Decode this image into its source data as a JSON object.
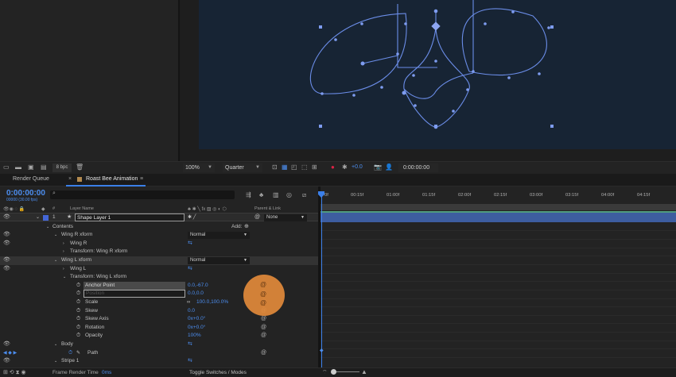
{
  "project_footer": {
    "bpc_label": "8 bpc"
  },
  "viewer_footer": {
    "zoom": "100%",
    "resolution": "Quarter",
    "exposure": "+0.0",
    "timecode": "0:00:00:00"
  },
  "tabs": [
    {
      "label": "Render Queue"
    },
    {
      "label": "Roast Bee Animation"
    }
  ],
  "timeline": {
    "current_time": "0:00:00:00",
    "frame_info": "00000 (30.00 fps)",
    "search_placeholder": "",
    "col_hash": "#",
    "col_layer_name": "Layer Name",
    "col_parent": "Parent & Link"
  },
  "layer": {
    "index": "1",
    "name": "Shape Layer 1",
    "parent": "None",
    "contents_label": "Contents",
    "add_label": "Add:"
  },
  "rows": {
    "wing_r_xform": "Wing R xform",
    "wing_r_mode": "Normal",
    "wing_r": "Wing R",
    "transform_wing_r": "Transform: Wing R xform",
    "wing_l_xform": "Wing L xform",
    "wing_l_mode": "Normal",
    "wing_l": "Wing L",
    "transform_wing_l": "Transform: Wing L xform",
    "anchor_point": "Anchor Point",
    "anchor_point_val": "0.0,-67.0",
    "position": "Position",
    "position_val": "0.0,0.0",
    "scale": "Scale",
    "scale_val": "100.0,100.0%",
    "skew": "Skew",
    "skew_val": "0.0",
    "skew_axis": "Skew Axis",
    "skew_axis_val": "0x+0.0°",
    "rotation": "Rotation",
    "rotation_val": "0x+0.0°",
    "opacity": "Opacity",
    "opacity_val": "100%",
    "body": "Body",
    "path": "Path",
    "stripe_1": "Stripe 1"
  },
  "ruler_ticks": [
    "0f",
    "00:15f",
    "01:00f",
    "01:15f",
    "02:00f",
    "02:15f",
    "03:00f",
    "03:15f",
    "04:00f",
    "04:15f"
  ],
  "bottom_bar": {
    "frame_render_label": "Frame Render Time",
    "frame_render_value": "0ms",
    "toggle_label": "Toggle Switches / Modes"
  },
  "colors": {
    "accent_blue": "#3b7fe8",
    "canvas_bg": "#172434",
    "path_color": "#6b8de8",
    "layer_bar": "#3d5da0",
    "highlight_orange": "#e0893a"
  }
}
